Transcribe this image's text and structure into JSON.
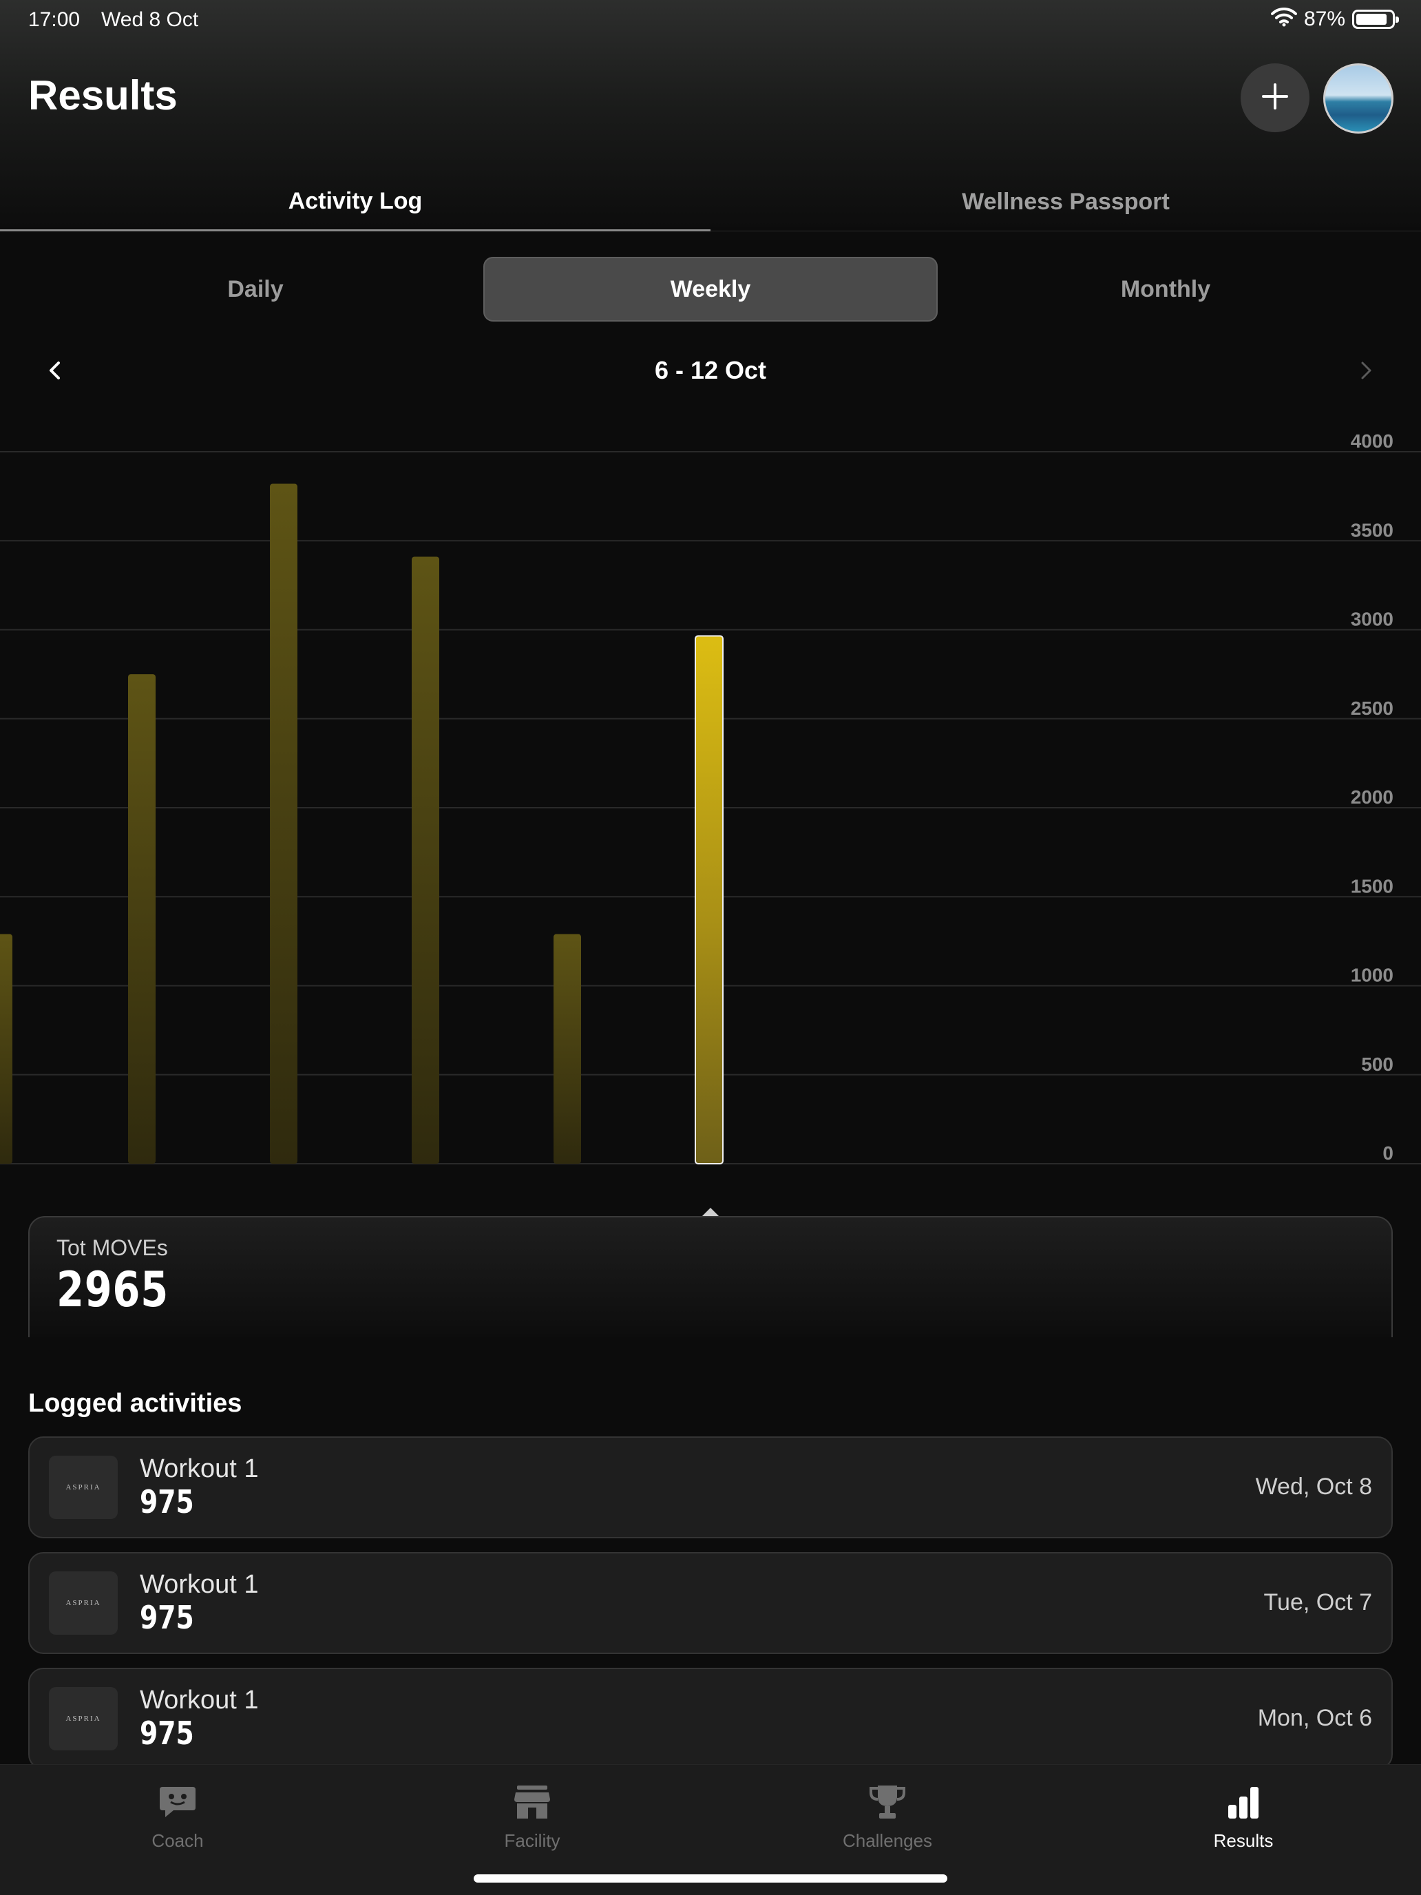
{
  "status_bar": {
    "time": "17:00",
    "date": "Wed 8 Oct",
    "battery": "87%"
  },
  "header": {
    "title": "Results"
  },
  "main_tabs": [
    {
      "label": "Activity Log",
      "active": true
    },
    {
      "label": "Wellness Passport",
      "active": false
    }
  ],
  "periods": [
    {
      "label": "Daily",
      "selected": false
    },
    {
      "label": "Weekly",
      "selected": true
    },
    {
      "label": "Monthly",
      "selected": false
    }
  ],
  "range": {
    "label": "6 - 12 Oct"
  },
  "chart_data": {
    "type": "bar",
    "ylim": [
      0,
      4000
    ],
    "yticks": [
      "4000",
      "3500",
      "3000",
      "2500",
      "2000",
      "1500",
      "1000",
      "500",
      "0"
    ],
    "values": [
      1290,
      2750,
      3820,
      3410,
      1290,
      2965
    ],
    "selected_index": 5,
    "grid": true,
    "colors": {
      "bar_dim": "#5c5214",
      "bar_selected": "#d9bb13",
      "grid": "#2a2a2a",
      "tick": "#8c8c8c"
    }
  },
  "total": {
    "label": "Tot MOVEs",
    "value": "2965"
  },
  "section_title": "Logged activities",
  "activities": [
    {
      "logo": "ASPRIA",
      "name": "Workout 1",
      "value": "975",
      "date": "Wed, Oct 8"
    },
    {
      "logo": "ASPRIA",
      "name": "Workout 1",
      "value": "975",
      "date": "Tue, Oct 7"
    },
    {
      "logo": "ASPRIA",
      "name": "Workout 1",
      "value": "975",
      "date": "Mon, Oct 6"
    }
  ],
  "bottom_nav": [
    {
      "label": "Coach",
      "icon": "coach-chat-icon",
      "active": false
    },
    {
      "label": "Facility",
      "icon": "facility-store-icon",
      "active": false
    },
    {
      "label": "Challenges",
      "icon": "trophy-icon",
      "active": false
    },
    {
      "label": "Results",
      "icon": "bar-chart-icon",
      "active": true
    }
  ]
}
